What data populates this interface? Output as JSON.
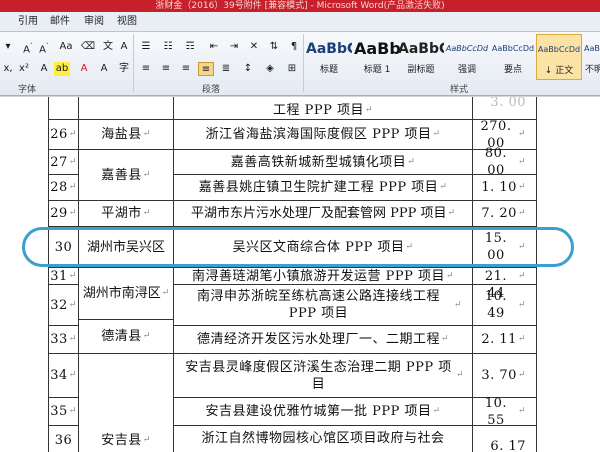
{
  "window": {
    "title": "浙财金（2016）39号附件 [兼容模式] - Microsoft Word(产品激活失败)"
  },
  "tabs": [
    "引用",
    "邮件",
    "审阅",
    "视图"
  ],
  "ribbon": {
    "font_group_label": "字体",
    "paragraph_group_label": "段落",
    "styles_group_label": "样式",
    "styles": [
      {
        "sample": "AaBbC",
        "name": "标题"
      },
      {
        "sample": "AaBb",
        "name": "标题 1"
      },
      {
        "sample": "AaBbC",
        "name": "副标题"
      },
      {
        "sample": "AaBbCcDd",
        "name": "强调"
      },
      {
        "sample": "AaBbCcDd",
        "name": "要点"
      },
      {
        "sample": "AaBbCcDd",
        "name": "↓ 正文"
      },
      {
        "sample": "AaBbCcDd",
        "name": "不明"
      }
    ]
  },
  "table": {
    "rows": [
      {
        "no": "26",
        "region": "海盐县",
        "project": "浙江省海盐滨海国际度假区 PPP 项目",
        "amount": "270. 00"
      },
      {
        "no": "27",
        "region": "嘉善县",
        "project": "嘉善高铁新城新型城镇化项目",
        "amount": "80. 00"
      },
      {
        "no": "28",
        "region": "",
        "project": "嘉善县姚庄镇卫生院扩建工程 PPP 项目",
        "amount": "1. 10"
      },
      {
        "no": "29",
        "region": "平湖市",
        "project": "平湖市东片污水处理厂及配套管网 PPP 项目",
        "amount": "7. 20"
      },
      {
        "no": "30",
        "region": "湖州市吴兴区",
        "project": "吴兴区文商综合体 PPP 项目",
        "amount": "15. 00"
      },
      {
        "no": "31",
        "region": "湖州市南浔区",
        "project": "南浔善琏湖笔小镇旅游开发运营 PPP 项目",
        "amount": "21. 44"
      },
      {
        "no": "32",
        "region": "",
        "project": "南浔申苏浙皖至练杭高速公路连接线工程 PPP 项目",
        "amount": "10. 49"
      },
      {
        "no": "33",
        "region": "德清县",
        "project": "德清经济开发区污水处理厂一、二期工程",
        "amount": "2. 11"
      },
      {
        "no": "34",
        "region": "安吉县",
        "project": "安吉县灵峰度假区浒溪生态治理二期 PPP 项目",
        "amount": "3. 70"
      },
      {
        "no": "35",
        "region": "",
        "project": "安吉县建设优雅竹城第一批 PPP 项目",
        "amount": "10. 55"
      },
      {
        "no": "36",
        "region": "",
        "project": "浙江自然博物园核心馆区项目政府与社会",
        "amount": "6. 17"
      }
    ],
    "top_partial": {
      "project": "工程 PPP 项目",
      "amount": "3. 00"
    },
    "para_mark": "↵"
  }
}
